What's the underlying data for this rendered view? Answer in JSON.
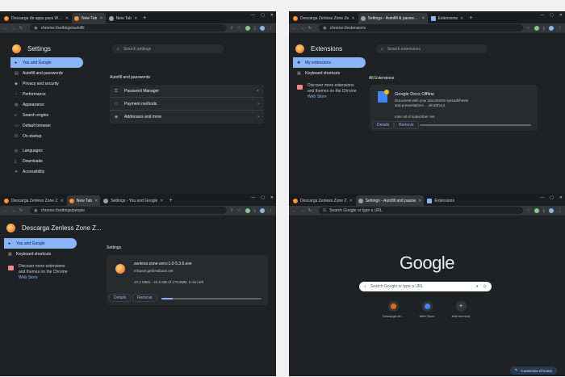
{
  "colors": {
    "accent": "#8ab4f8",
    "window_bg": "#202124",
    "toolbar_bg": "#35363a"
  },
  "w1": {
    "tabs": [
      {
        "label": "Descarga de apps para Wind",
        "icon": "fire",
        "active": false
      },
      {
        "label": "New Tab",
        "icon": "fire",
        "active": true
      },
      {
        "label": "New Tab",
        "icon": "gear",
        "active": false
      }
    ],
    "url": "chrome://settings/autofill",
    "page_title": "Settings",
    "search_placeholder": "Search settings",
    "sidebar": [
      {
        "label": "You and Google",
        "icon": "person-icon",
        "glyph": "●",
        "selected": true
      },
      {
        "label": "Autofill and passwords",
        "icon": "clipboard-icon",
        "glyph": "▤",
        "selected": false
      },
      {
        "label": "Privacy and security",
        "icon": "shield-icon",
        "glyph": "◆",
        "selected": false
      },
      {
        "label": "Performance",
        "icon": "speedometer-icon",
        "glyph": "◔",
        "selected": false
      },
      {
        "label": "Appearance",
        "icon": "palette-icon",
        "glyph": "◍",
        "selected": false
      },
      {
        "label": "Search engine",
        "icon": "search-icon",
        "glyph": "⌕",
        "selected": false
      },
      {
        "label": "Default browser",
        "icon": "browser-icon",
        "glyph": "▭",
        "selected": false
      },
      {
        "label": "On startup",
        "icon": "power-icon",
        "glyph": "⏻",
        "selected": false
      }
    ],
    "sidebar2": [
      {
        "label": "Languages",
        "icon": "globe-icon",
        "glyph": "◎"
      },
      {
        "label": "Downloads",
        "icon": "download-icon",
        "glyph": "⤓"
      },
      {
        "label": "Accessibility",
        "icon": "accessibility-icon",
        "glyph": "✦"
      }
    ],
    "section_title": "Autofill and passwords",
    "rows": [
      {
        "label": "Password Manager",
        "icon": "key-icon",
        "glyph": "⚿",
        "end": "↗"
      },
      {
        "label": "Payment methods",
        "icon": "card-icon",
        "glyph": "▭",
        "end": "›"
      },
      {
        "label": "Addresses and more",
        "icon": "location-icon",
        "glyph": "◉",
        "end": "›"
      }
    ]
  },
  "w2": {
    "tabs": [
      {
        "label": "Descarga Zenless Zone Ze",
        "icon": "fire",
        "active": false
      },
      {
        "label": "Settings - Autofill & password",
        "icon": "gear",
        "active": true
      },
      {
        "label": "Extensions",
        "icon": "puzzle",
        "active": false
      }
    ],
    "url": "chrome://extensions",
    "page_title": "Extensions",
    "search_placeholder": "Search extensions",
    "sidebar": [
      {
        "label": "My extensions",
        "icon": "puzzle-icon",
        "glyph": "✚",
        "selected": true
      },
      {
        "label": "Keyboard shortcuts",
        "icon": "keyboard-icon",
        "glyph": "▦",
        "selected": false
      }
    ],
    "promo_text": "Discover more extensions and themes on the Chrome",
    "promo_link": "Web Store",
    "section_title": "All Extensions",
    "ext": {
      "name": "Google Docs Offline",
      "desc": "Document with your documents spreadsheets and presentations ... all without",
      "id": "Inter all of subscriber net",
      "details": "Details",
      "remove": "Remove"
    }
  },
  "w3": {
    "tabs": [
      {
        "label": "Descarga Zenless Zone Z",
        "icon": "fire",
        "active": false
      },
      {
        "label": "New Tab",
        "icon": "fire",
        "active": true
      },
      {
        "label": "Settings - You and Google",
        "icon": "gear",
        "active": false
      }
    ],
    "url": "chrome://settings/people",
    "page_title": "Descarga Zenless Zone Z...",
    "sidebar": [
      {
        "label": "You and Google",
        "icon": "puzzle-icon",
        "glyph": "●",
        "selected": true
      },
      {
        "label": "Keyboard shortcuts",
        "icon": "keyboard-icon",
        "glyph": "▦",
        "selected": false
      }
    ],
    "promo_text": "Discover more extensions and themes on the Chrome",
    "promo_link": "Web Store",
    "section_title": "Settings",
    "download": {
      "name": "zenless-zone-zero-1.0-5.3.6.exe",
      "site": "Infoport.getbestbase.net",
      "progress_text": "22.2 MB/s - 4n 5 MB of 178.8MB, 5 min left",
      "progress": 0.11,
      "details": "Details",
      "remove": "Remove"
    }
  },
  "w4": {
    "tabs": [
      {
        "label": "Descarga Zenless Zone Z",
        "icon": "fire",
        "active": false
      },
      {
        "label": "Settings - Autofill and passw",
        "icon": "gear",
        "active": true
      },
      {
        "label": "Extensions",
        "icon": "puzzle",
        "active": false
      }
    ],
    "url": "Search Google or type a URL",
    "logo_text": "Google",
    "search_placeholder": "Search Google or type a URL",
    "shortcuts": [
      {
        "label": "Descarga de...",
        "icon": "fire-icon",
        "color": "#e8671a"
      },
      {
        "label": "Web Store",
        "icon": "webstore-icon",
        "color": "#4285f4"
      },
      {
        "label": "Add shortcut",
        "icon": "plus-icon",
        "color": ""
      }
    ],
    "customize_label": "Customize Chrome"
  }
}
